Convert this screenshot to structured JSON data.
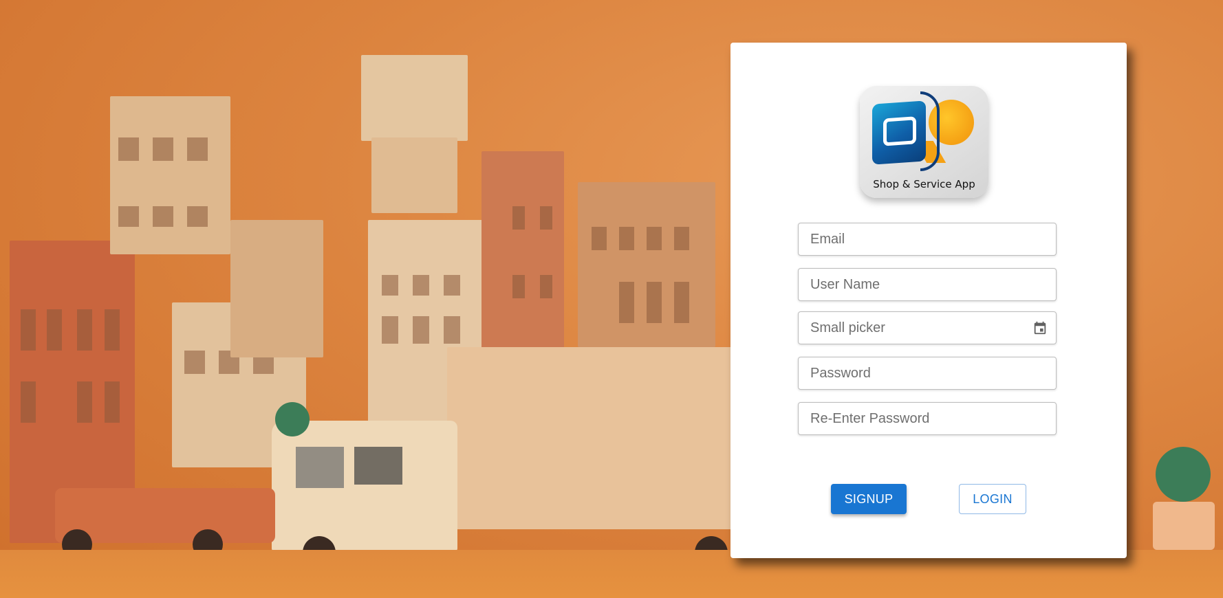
{
  "logo": {
    "caption": "Shop & Service App"
  },
  "form": {
    "email_placeholder": "Email",
    "username_placeholder": "User Name",
    "date_placeholder": "Small picker",
    "password_placeholder": "Password",
    "reenter_password_placeholder": "Re-Enter Password"
  },
  "buttons": {
    "signup": "SIGNUP",
    "login": "LOGIN"
  },
  "icons": {
    "date_picker": "calendar-icon"
  },
  "colors": {
    "primary": "#1976d2",
    "background": "#d9803e",
    "card": "#ffffff"
  }
}
